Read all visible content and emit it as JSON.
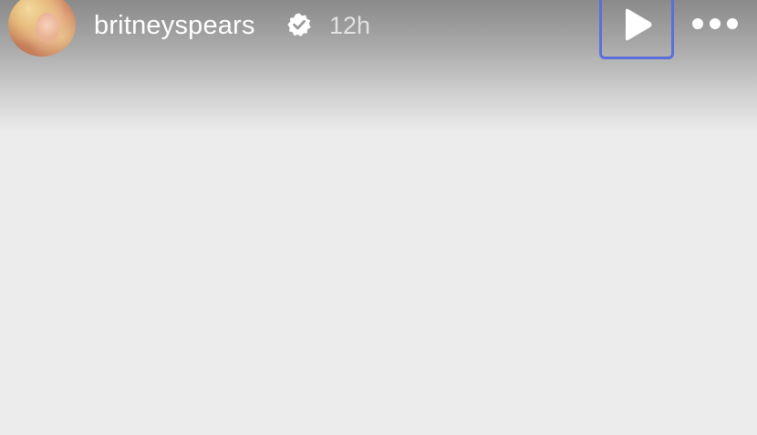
{
  "story": {
    "username": "britneyspears",
    "timestamp": "12h",
    "verified": true
  },
  "controls": {
    "play_icon": "play-icon",
    "more_icon": "more-horizontal-icon"
  },
  "colors": {
    "highlight": "#5b6fd8",
    "background": "#ececec"
  }
}
